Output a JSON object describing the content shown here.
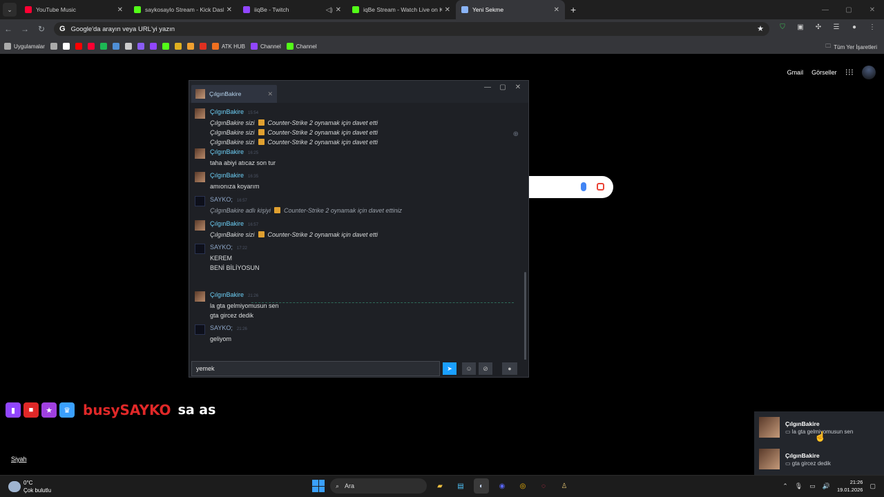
{
  "browser": {
    "tabs": [
      {
        "title": "YouTube Music",
        "color": "#ff0033",
        "audio": false
      },
      {
        "title": "saykosaylo Stream - Kick Dashb",
        "color": "#53fc18",
        "audio": false
      },
      {
        "title": "iiqBe - Twitch",
        "color": "#9146ff",
        "audio": true
      },
      {
        "title": "iqBe Stream - Watch Live on Ki",
        "color": "#53fc18",
        "audio": false
      },
      {
        "title": "Yeni Sekme",
        "color": "#8ab4f8",
        "audio": false,
        "active": true
      }
    ],
    "url_placeholder": "Google'da arayın veya URL'yi yazın",
    "bookmarks": [
      {
        "label": "Uygulamalar",
        "color": "#aaaaaa"
      },
      {
        "label": "",
        "color": "#aaaaaa"
      },
      {
        "label": "",
        "color": "#ffffff"
      },
      {
        "label": "",
        "color": "#ff0000"
      },
      {
        "label": "",
        "color": "#ff0033"
      },
      {
        "label": "",
        "color": "#1db954"
      },
      {
        "label": "",
        "color": "#4f8fd6"
      },
      {
        "label": "",
        "color": "#cccccc"
      },
      {
        "label": "",
        "color": "#8a5cf5"
      },
      {
        "label": "",
        "color": "#9146ff"
      },
      {
        "label": "",
        "color": "#53fc18"
      },
      {
        "label": "",
        "color": "#e0b020"
      },
      {
        "label": "",
        "color": "#f0a030"
      },
      {
        "label": "",
        "color": "#e03020"
      },
      {
        "label": "ATK HUB",
        "color": "#f07020"
      },
      {
        "label": "Channel",
        "color": "#9146ff"
      },
      {
        "label": "Channel",
        "color": "#53fc18"
      }
    ],
    "bookmarks_right": "Tüm Yer İşaretleri"
  },
  "google": {
    "gmail": "Gmail",
    "images": "Görseller"
  },
  "chat": {
    "tab_name": "ÇılgınBakire",
    "messages": [
      {
        "sender": "ÇılgınBakire",
        "type": "cb",
        "time": "15:54",
        "lines": [],
        "invites": [
          "Counter-Strike 2 oynamak için davet etti",
          "Counter-Strike 2 oynamak için davet etti",
          "Counter-Strike 2 oynamak için davet etti"
        ],
        "invite_prefix": "ÇılgınBakire sizi"
      },
      {
        "sender": "ÇılgınBakire",
        "type": "cb",
        "time": "16:25",
        "lines": [
          "taha abiyi atıcaz son tur"
        ]
      },
      {
        "sender": "ÇılgınBakire",
        "type": "cb",
        "time": "16:35",
        "lines": [
          "amıonıza koyarım"
        ]
      },
      {
        "sender": "SAYKO;",
        "type": "sy",
        "time": "16:57",
        "self_invite_prefix": "ÇılgınBakire adlı kişiyi",
        "self_invite": "Counter-Strike 2 oynamak için davet ettiniz"
      },
      {
        "sender": "ÇılgınBakire",
        "type": "cb",
        "time": "16:57",
        "invite_prefix": "ÇılgınBakire sizi",
        "invites": [
          "Counter-Strike 2 oynamak için davet etti"
        ]
      },
      {
        "sender": "SAYKO;",
        "type": "sy",
        "time": "17:22",
        "lines": [
          "KEREM",
          "BENİ BİLİYOSUN"
        ]
      },
      {
        "sender": "ÇılgınBakire",
        "type": "cb",
        "time": "21:26",
        "lines": [
          "la gta gelmiyomusun sen",
          "gta gircez dedik"
        ]
      },
      {
        "sender": "SAYKO;",
        "type": "sy",
        "time": "21:26",
        "lines": [
          "geliyom"
        ]
      }
    ],
    "input_value": "yemek"
  },
  "overlay": {
    "username": "busySAYKO",
    "message": "sa as",
    "colors": [
      "#9146ff",
      "#e02828",
      "#a040e0",
      "#3aa0ff"
    ]
  },
  "siyah": "Siyah",
  "notifications": [
    {
      "name": "ÇılgınBakire",
      "text": "la gta gelmiyomusun sen"
    },
    {
      "name": "ÇılgınBakire",
      "text": "gta gircez dedik"
    }
  ],
  "taskbar": {
    "temp": "0°C",
    "weather": "Çok bulutlu",
    "search": "Ara",
    "time": "21:26",
    "date": "19.01.2026"
  }
}
